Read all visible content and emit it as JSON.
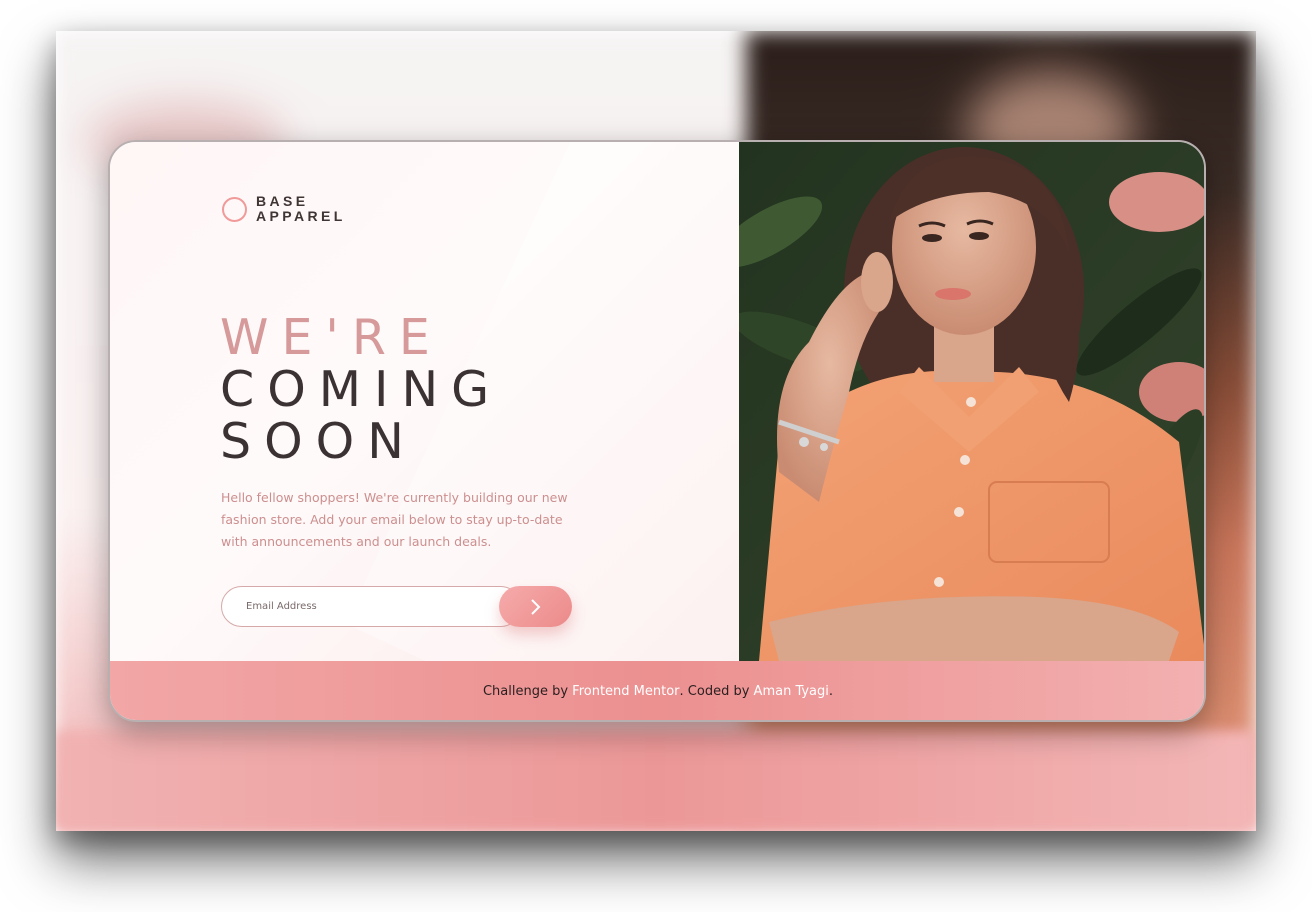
{
  "brand": {
    "line1": "BASE",
    "line2": "APPAREL"
  },
  "headline": {
    "line1": "WE'RE",
    "line2": "COMING",
    "line3": "SOON"
  },
  "description": "Hello fellow shoppers! We're currently building our new fashion store. Add your email below to stay up-to-date with announcements and our launch deals.",
  "form": {
    "email_placeholder": "Email Address",
    "submit_icon": "chevron-right-icon"
  },
  "hero_image": {
    "icon": "model-photo"
  },
  "footer": {
    "prefix": "Challenge by ",
    "link1": "Frontend Mentor",
    "middle": ". Coded by ",
    "link2": "Aman Tyagi",
    "suffix": "."
  },
  "colors": {
    "accent": "#f09a9a",
    "text_dark": "#3b3333",
    "text_pink": "#cc8f8f"
  }
}
